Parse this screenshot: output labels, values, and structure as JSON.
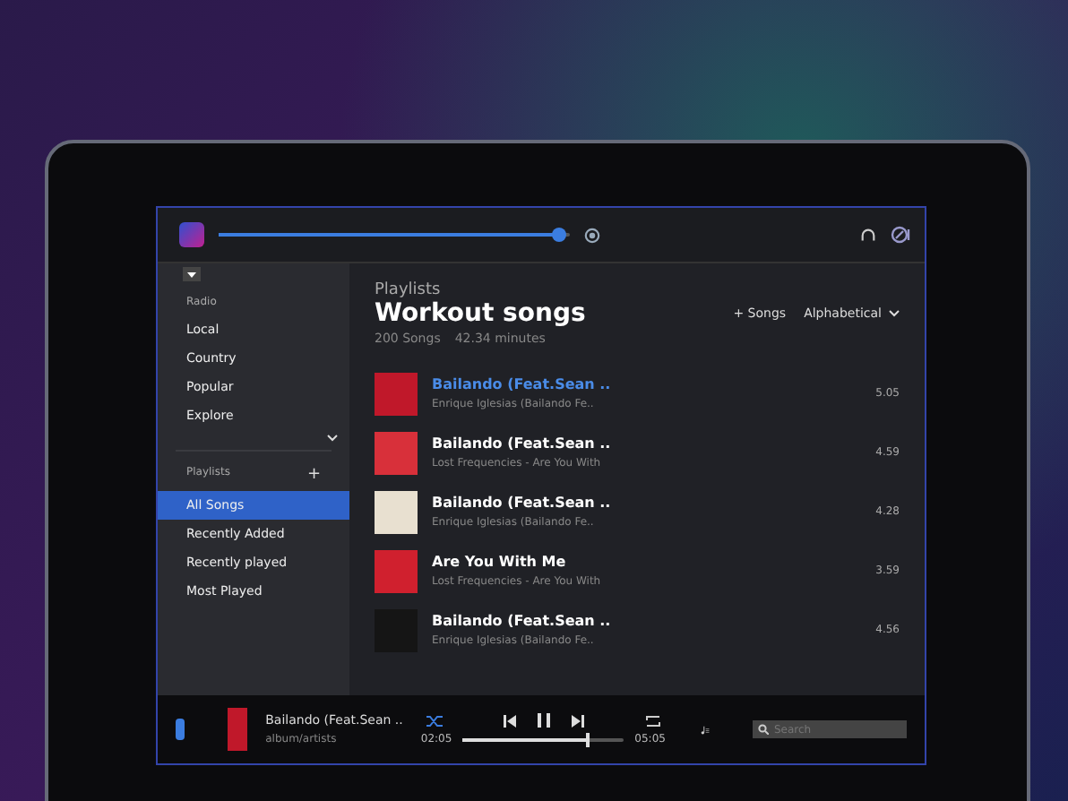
{
  "topbar": {
    "volume": {
      "level": 0.97
    }
  },
  "sidebar": {
    "radio_heading": "Radio",
    "radio_items": [
      "Local",
      "Country",
      "Popular",
      "Explore"
    ],
    "playlists_heading": "Playlists",
    "add_button": "+",
    "playlists": [
      {
        "label": "All Songs",
        "selected": true
      },
      {
        "label": "Recently Added",
        "selected": false
      },
      {
        "label": "Recently played",
        "selected": false
      },
      {
        "label": "Most Played",
        "selected": false
      }
    ]
  },
  "header": {
    "section": "Playlists",
    "title": "Workout songs",
    "count": "200 Songs",
    "duration": "42.34 minutes",
    "add_songs": "+ Songs",
    "sort": "Alphabetical"
  },
  "songs": [
    {
      "title": "Bailando (Feat.Sean ..",
      "artist": "Enrique Iglesias (Bailando Fe..",
      "duration": "5.05",
      "selected": true,
      "color": "#c0182a"
    },
    {
      "title": "Bailando (Feat.Sean ..",
      "artist": "Lost Frequencies - Are You With",
      "duration": "4.59",
      "selected": false,
      "color": "#d8303a"
    },
    {
      "title": "Bailando (Feat.Sean ..",
      "artist": "Enrique Iglesias (Bailando Fe..",
      "duration": "4.28",
      "selected": false,
      "color": "#e8e0d0"
    },
    {
      "title": "Are You With Me",
      "artist": "Lost Frequencies - Are You With",
      "duration": "3.59",
      "selected": false,
      "color": "#d0202e"
    },
    {
      "title": "Bailando (Feat.Sean ..",
      "artist": "Enrique Iglesias (Bailando Fe..",
      "duration": "4.56",
      "selected": false,
      "color": "#151515"
    }
  ],
  "player": {
    "title": "Bailando (Feat.Sean ..",
    "subtitle": "album/artists",
    "elapsed": "02:05",
    "total": "05:05",
    "progress": {
      "level": 0.78
    },
    "shuffle": true,
    "search": {
      "placeholder": "Search"
    }
  }
}
